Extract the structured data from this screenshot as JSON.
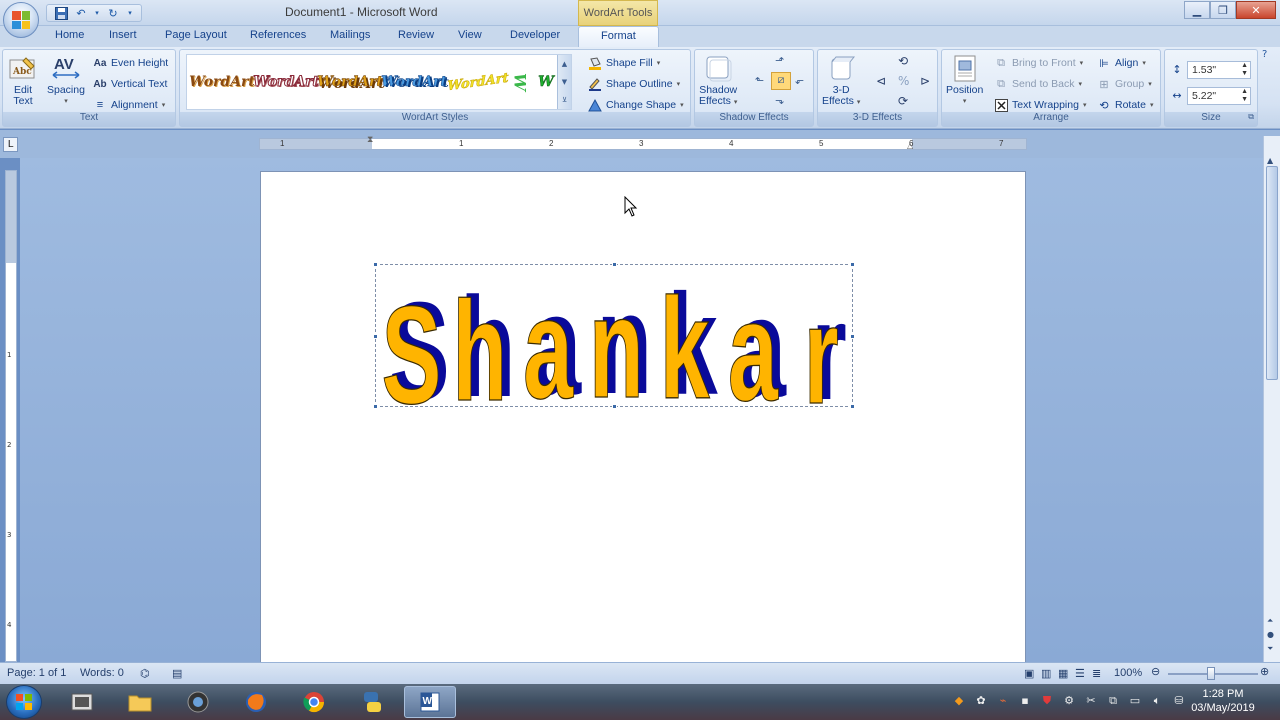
{
  "window": {
    "title": "Document1 - Microsoft Word",
    "contextual_tab_group": "WordArt Tools"
  },
  "tabs": [
    "Home",
    "Insert",
    "Page Layout",
    "References",
    "Mailings",
    "Review",
    "View",
    "Developer",
    "Format"
  ],
  "active_tab": "Format",
  "ribbon": {
    "text_group": {
      "label": "Text",
      "edit_text_1": "Edit",
      "edit_text_2": "Text",
      "spacing": "Spacing",
      "even_height": "Even Height",
      "vertical_text": "Vertical Text",
      "alignment": "Alignment"
    },
    "styles_group": {
      "label": "WordArt Styles",
      "gallery": [
        "WordArt",
        "WordArt",
        "WordArt",
        "WordArt",
        "WordArt",
        "W",
        "W"
      ],
      "shape_fill": "Shape Fill",
      "shape_outline": "Shape Outline",
      "change_shape": "Change Shape"
    },
    "shadow_group": {
      "label": "Shadow Effects",
      "shadow_effects_1": "Shadow",
      "shadow_effects_2": "Effects"
    },
    "threed_group": {
      "label": "3-D Effects",
      "threed_1": "3-D",
      "threed_2": "Effects"
    },
    "arrange_group": {
      "label": "Arrange",
      "position": "Position",
      "bring_to_front": "Bring to Front",
      "send_to_back": "Send to Back",
      "text_wrapping": "Text Wrapping",
      "align": "Align",
      "group": "Group",
      "rotate": "Rotate"
    },
    "size_group": {
      "label": "Size",
      "height": "1.53\"",
      "width": "5.22\""
    }
  },
  "ruler": {
    "h_ticks": [
      "1",
      "1",
      "2",
      "3",
      "4",
      "5",
      "6",
      "7"
    ],
    "v_ticks": [
      "1",
      "2",
      "3",
      "4"
    ]
  },
  "document": {
    "wordart_text": "Shankar",
    "fill_color": "#ffb400",
    "shadow_color": "#0a0a9a"
  },
  "status": {
    "page": "Page: 1 of 1",
    "words": "Words: 0",
    "zoom": "100%"
  },
  "taskbar": {
    "time": "1:28 PM",
    "date": "03/May/2019"
  }
}
